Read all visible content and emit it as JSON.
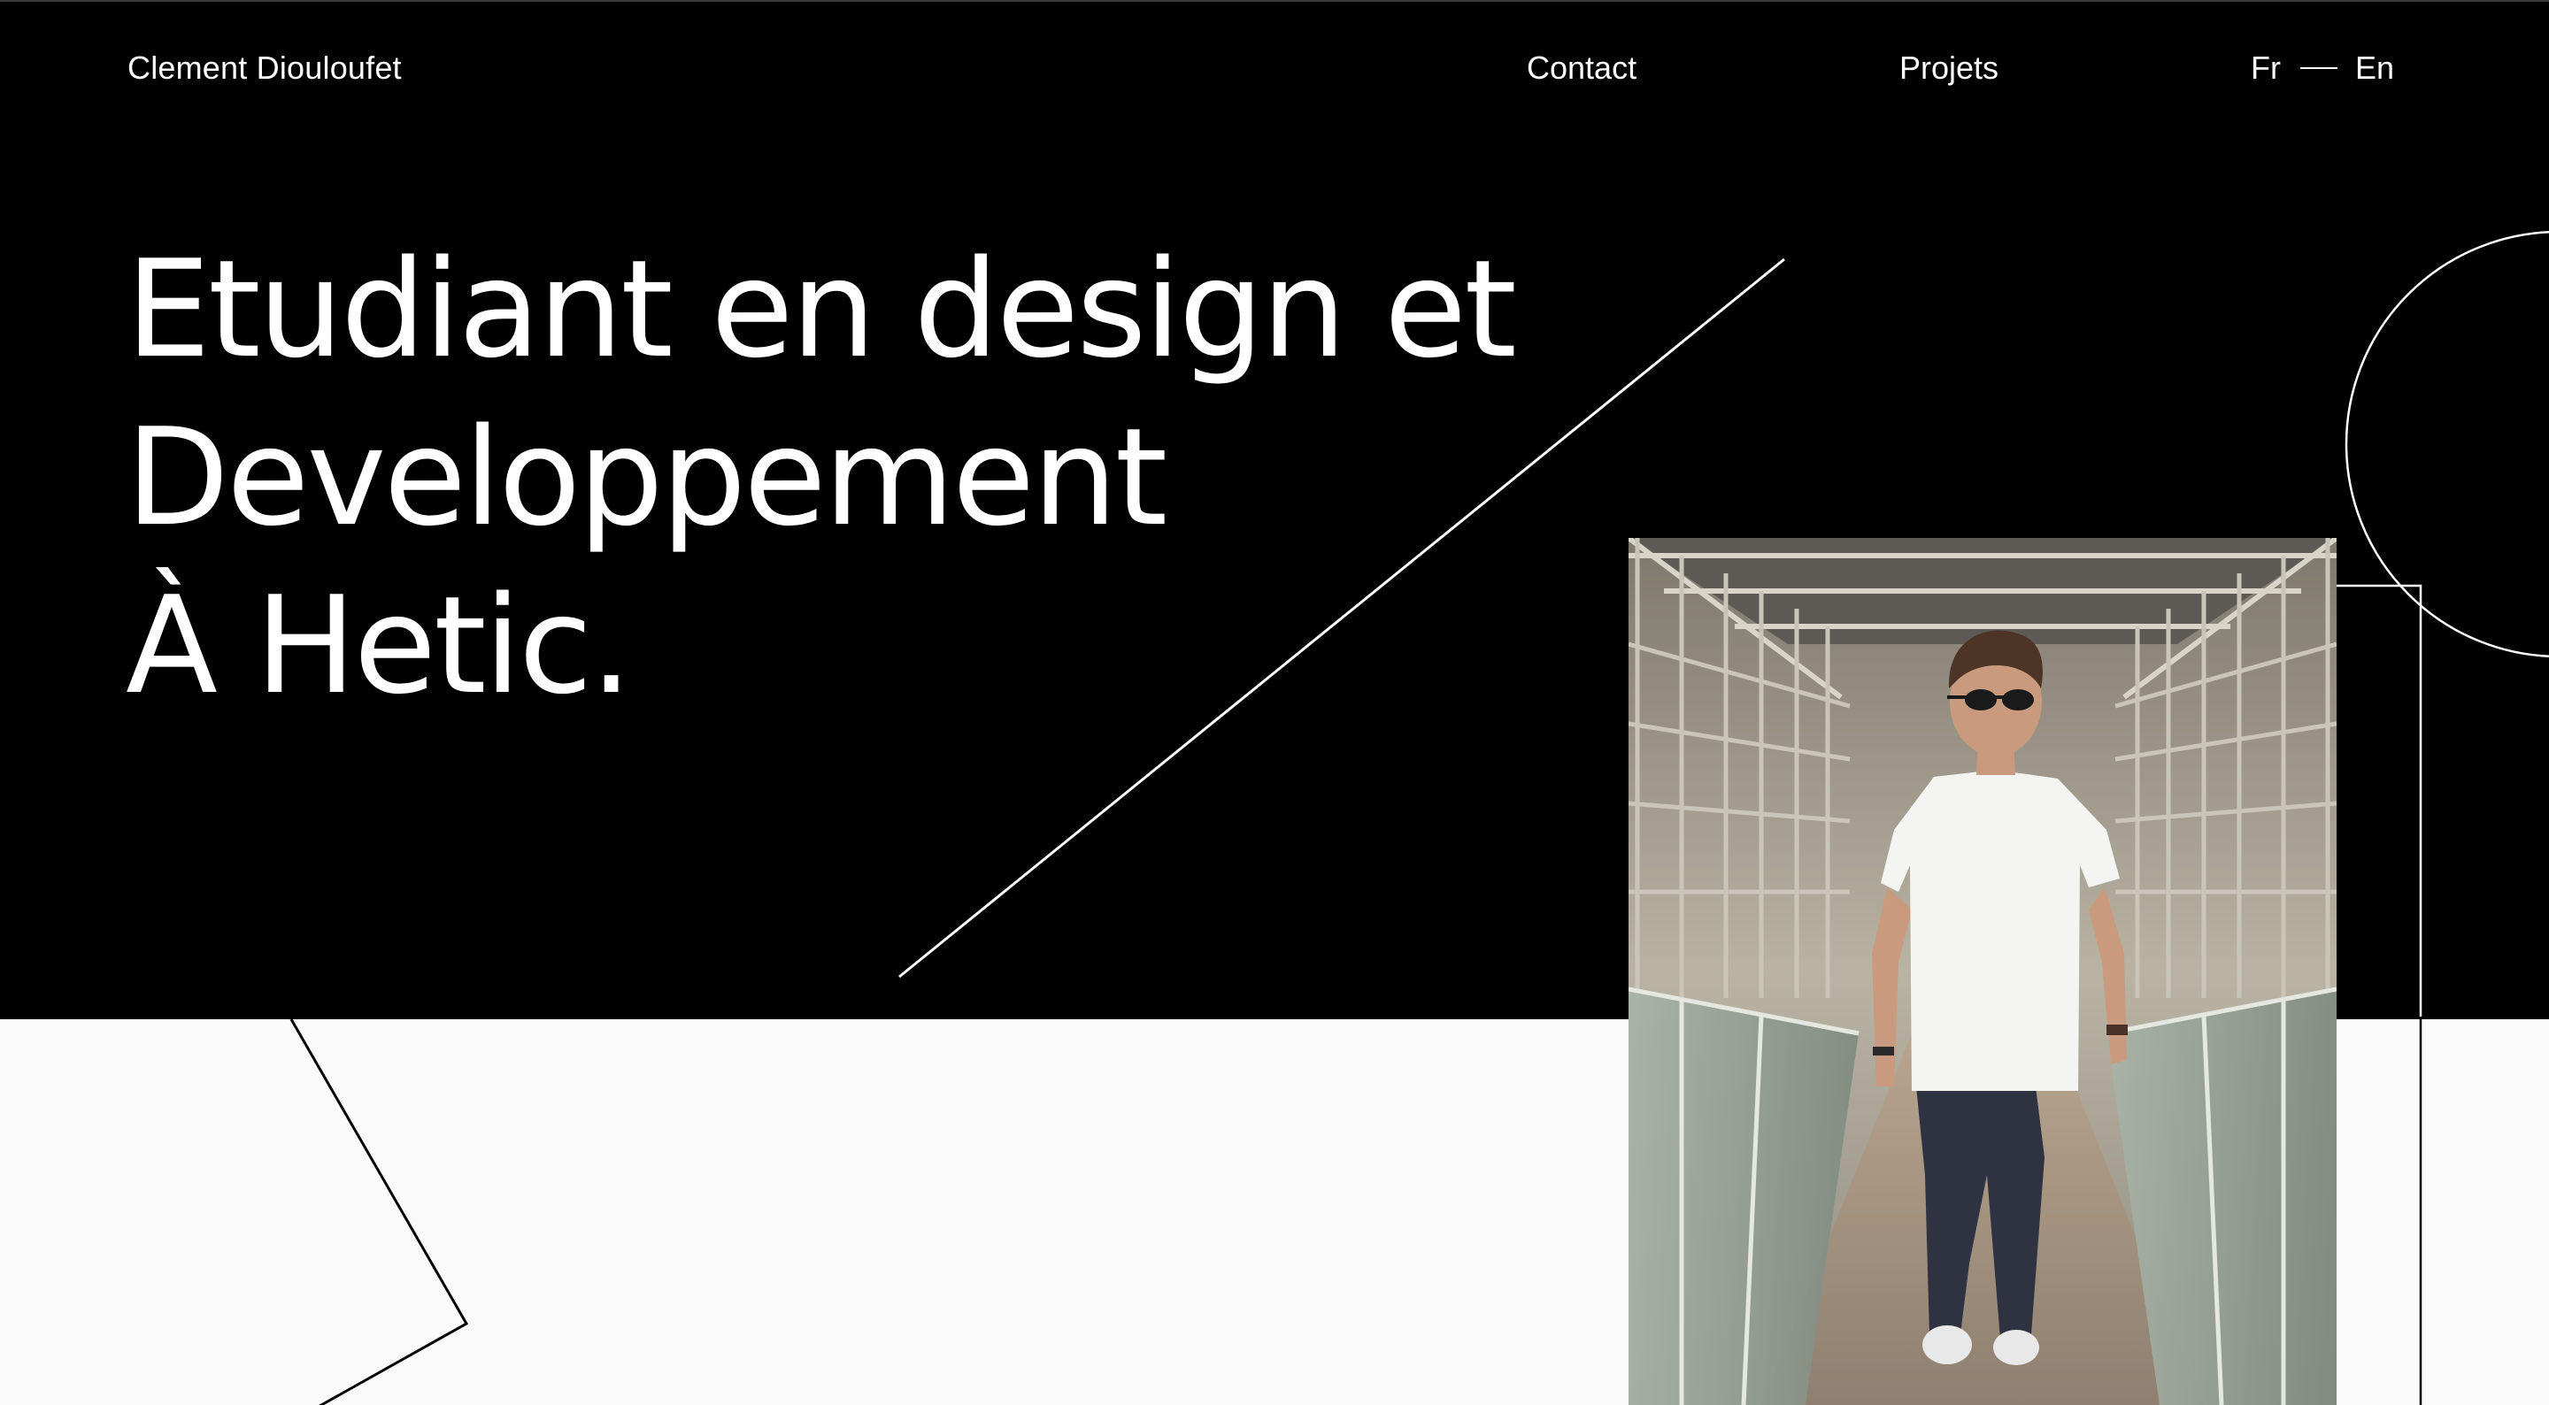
{
  "header": {
    "name": "Clement Diouloufet",
    "nav": {
      "contact": "Contact",
      "projets": "Projets"
    },
    "languages": {
      "fr": "Fr",
      "en": "En"
    }
  },
  "hero": {
    "title_lines": [
      "Etudiant en design et",
      "Developpement",
      "À Hetic."
    ]
  },
  "colors": {
    "hero_background": "#000000",
    "page_background": "#fafafa",
    "text_on_dark": "#ffffff"
  },
  "icons": {
    "lang_separator": "horizontal-dash"
  }
}
